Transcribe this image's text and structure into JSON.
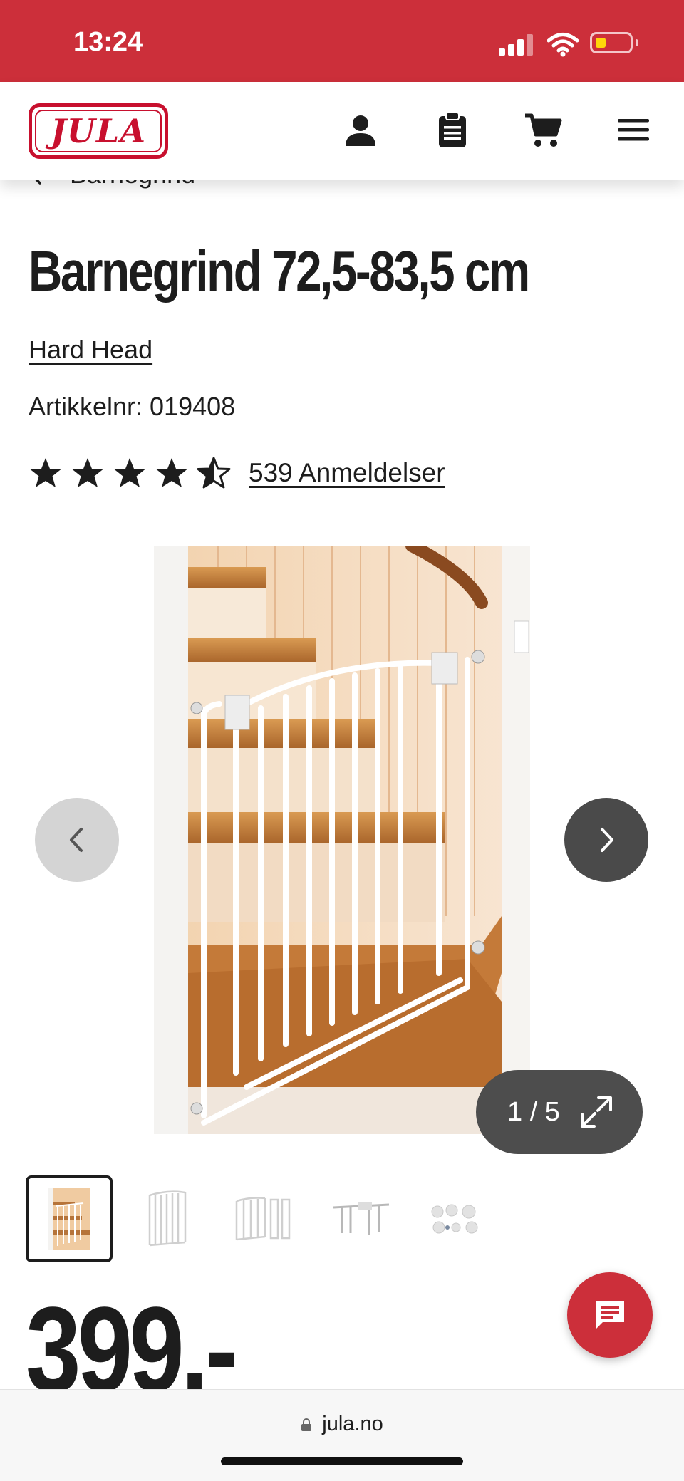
{
  "status_bar": {
    "time": "13:24",
    "background": "#cc2f3a"
  },
  "header": {
    "logo_text": "JULA",
    "icons": [
      "account-icon",
      "shopping-list-icon",
      "cart-icon",
      "menu-icon"
    ]
  },
  "breadcrumb": {
    "label": "Barnegrind"
  },
  "product": {
    "title": "Barnegrind 72,5-83,5 cm",
    "brand": "Hard Head",
    "article_number": "Artikkelnr: 019408",
    "rating": 4.5,
    "rating_max": 5,
    "reviews_label": "539 Anmeldelser",
    "price": "399.-"
  },
  "gallery": {
    "counter": "1 / 5",
    "current": 1,
    "total": 5,
    "thumbnails": [
      "stairs-gate-photo",
      "gate-front",
      "gate-with-extensions",
      "gate-hardware",
      "mounting-cups"
    ]
  },
  "browser": {
    "url": "jula.no"
  },
  "colors": {
    "brand_red": "#cc2f3a",
    "text": "#1d1d1d"
  }
}
